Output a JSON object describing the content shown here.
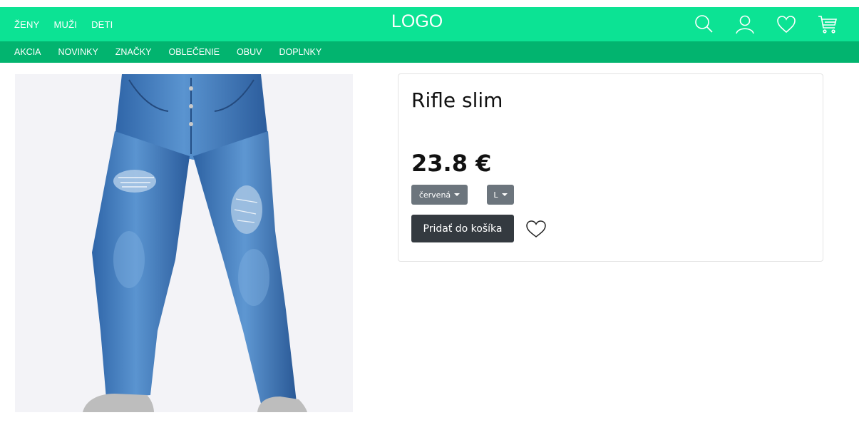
{
  "header": {
    "top_nav": [
      "ŽENY",
      "MUŽI",
      "DETI"
    ],
    "logo": "LOGO",
    "icons": [
      "search-icon",
      "user-icon",
      "heart-icon",
      "cart-icon"
    ]
  },
  "subnav": [
    "AKCIA",
    "NOVINKY",
    "ZNAČKY",
    "OBLEČENIE",
    "OBUV",
    "DOPLNKY"
  ],
  "product": {
    "title": "Rifle slim",
    "price": "23.8 €",
    "color_option": "červená",
    "size_option": "L",
    "add_to_cart": "Pridať do košíka",
    "wishlist_icon": "heart-outline-icon"
  },
  "colors": {
    "top_bar": "#0ce394",
    "sub_bar": "#02b46f",
    "button_dark": "#343a40",
    "dropdown_gray": "#6c757d",
    "denim": "#3c78bb"
  }
}
